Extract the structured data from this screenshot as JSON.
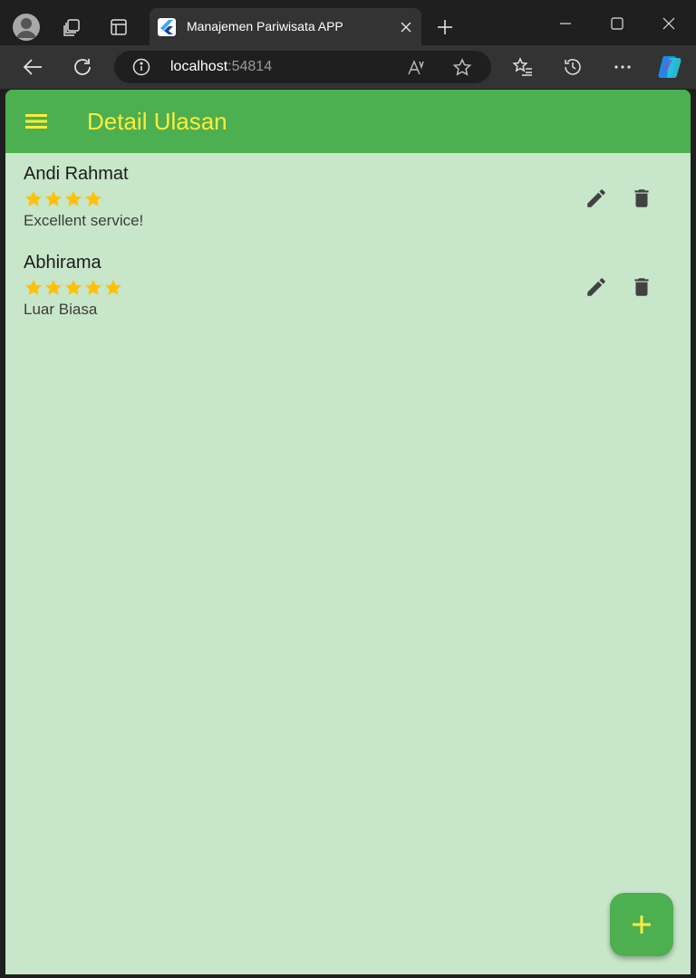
{
  "browser": {
    "tab_title": "Manajemen Pariwisata APP",
    "address_host": "localhost",
    "address_port": ":54814",
    "icons": [
      "profile-icon",
      "workspaces-icon",
      "tab-actions-icon",
      "flutter-favicon",
      "close-icon",
      "new-tab-icon",
      "minimize-icon",
      "maximize-icon",
      "window-close-icon",
      "back-icon",
      "refresh-icon",
      "info-icon",
      "read-aloud-icon",
      "favorite-icon",
      "favorites-icon",
      "history-icon",
      "more-icon",
      "copilot-icon"
    ]
  },
  "appbar": {
    "title": "Detail Ulasan",
    "title_color": "#ffeb3b",
    "background_color": "#4caf50"
  },
  "reviews": [
    {
      "name": "Andi Rahmat",
      "rating": 4,
      "comment": "Excellent service!"
    },
    {
      "name": "Abhirama",
      "rating": 5,
      "comment": "Luar Biasa"
    }
  ],
  "colors": {
    "page_background": "#c8e6c9",
    "star": "#ffc107",
    "icon": "#424242"
  },
  "fab": {
    "icon": "plus-icon"
  }
}
